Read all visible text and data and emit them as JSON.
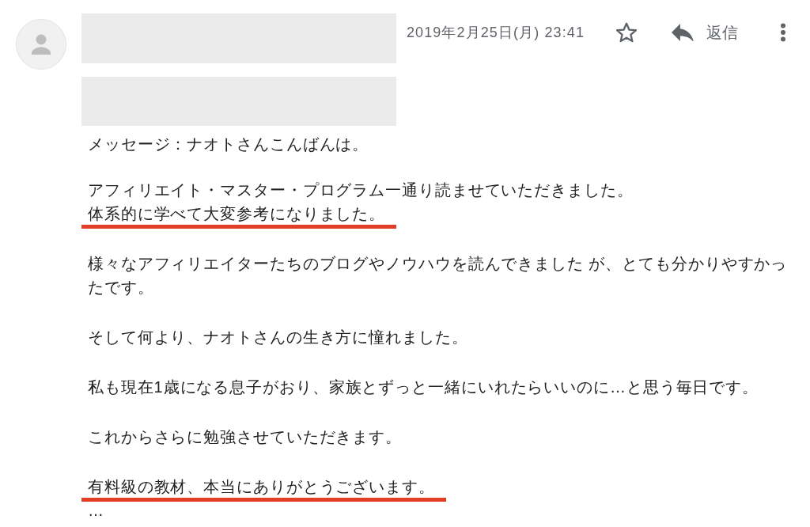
{
  "message": {
    "date": "2019年2月25日(月) 23:41",
    "starred": false,
    "reply_label": "返信"
  },
  "body": {
    "paragraphs": [
      {
        "lines": [
          {
            "text": "メッセージ：ナオトさんこんばんは。",
            "underlined": false
          }
        ]
      },
      {
        "lines": [
          {
            "text": "アフィリエイト・マスター・プログラム一通り読ませていただきました。",
            "underlined": false
          },
          {
            "text": "体系的に学べて大変参考になりました。",
            "underlined": true
          }
        ]
      },
      {
        "lines": [
          {
            "text": "様々なアフィリエイターたちのブログやノウハウを読んできました が、とても分かりやすかったです。",
            "underlined": false
          }
        ]
      },
      {
        "lines": [
          {
            "text": "そして何より、ナオトさんの生き方に憧れました。",
            "underlined": false
          }
        ]
      },
      {
        "lines": [
          {
            "text": "私も現在1歳になる息子がおり、家族とずっと一緒にいれたらいいのに…と思う毎日です。",
            "underlined": false
          }
        ]
      },
      {
        "lines": [
          {
            "text": "これからさらに勉強させていただきます。",
            "underlined": false
          }
        ]
      },
      {
        "lines": [
          {
            "text": "有料級の教材、本当にありがとうございます。",
            "underlined": true
          },
          {
            "text": "…",
            "underlined": false
          }
        ]
      }
    ]
  }
}
